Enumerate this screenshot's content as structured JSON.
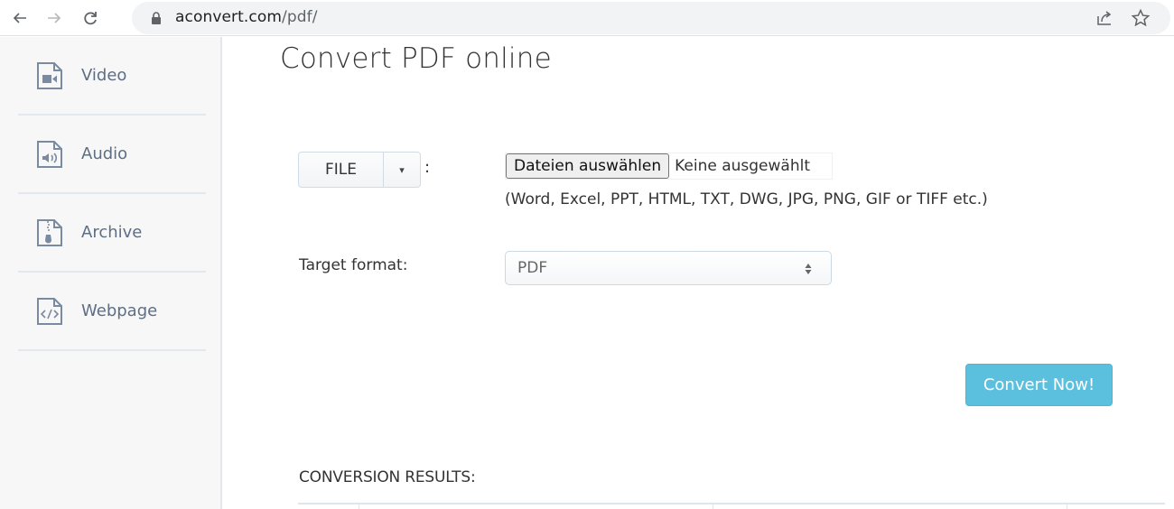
{
  "browser": {
    "url_domain": "aconvert.com",
    "url_path": "/pdf/",
    "icons": [
      "back-arrow-icon",
      "forward-arrow-icon",
      "reload-icon",
      "lock-icon",
      "share-icon",
      "bookmark-star-icon"
    ]
  },
  "sidebar": {
    "items": [
      {
        "label": "Video",
        "icon": "video-file-icon"
      },
      {
        "label": "Audio",
        "icon": "audio-file-icon"
      },
      {
        "label": "Archive",
        "icon": "archive-file-icon"
      },
      {
        "label": "Webpage",
        "icon": "webpage-file-icon"
      }
    ]
  },
  "main": {
    "title": "Convert PDF online",
    "source": {
      "type_button_label": "FILE",
      "caret": "▾",
      "colon": ":",
      "choose_button_label": "Dateien auswählen",
      "no_file_text": "Keine ausgewählt",
      "hint": "(Word, Excel, PPT, HTML, TXT, DWG, JPG, PNG, GIF or TIFF etc.)"
    },
    "target": {
      "label": "Target format:",
      "selected": "PDF"
    },
    "convert_button_label": "Convert Now!",
    "results_title": "CONVERSION RESULTS:"
  },
  "colors": {
    "accent": "#5bc0de",
    "sidebar_text": "#5d6e85",
    "sidebar_bg": "#f7f7f7"
  }
}
